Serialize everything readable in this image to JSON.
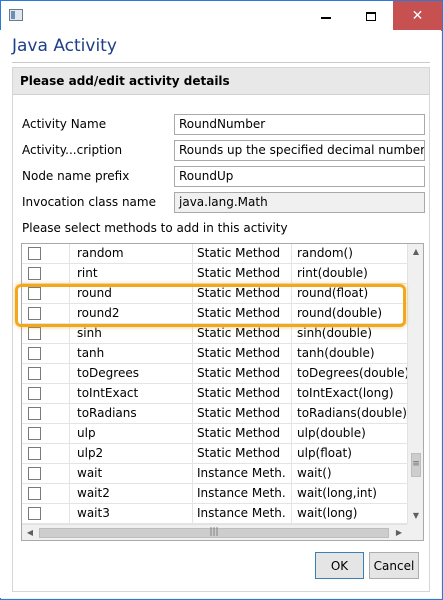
{
  "window": {
    "title": "Java Activity",
    "buttons": {
      "minimize": "minimize",
      "maximize": "maximize",
      "close": "✕"
    }
  },
  "panel": {
    "header": "Please add/edit activity details"
  },
  "fields": {
    "activity_name": {
      "label": "Activity Name",
      "value": "RoundNumber"
    },
    "description": {
      "label": "Activity...cription",
      "value": "Rounds up the specified decimal number to th"
    },
    "node_prefix": {
      "label": "Node name prefix",
      "value": "RoundUp"
    },
    "class_name": {
      "label": "Invocation class name",
      "value": "java.lang.Math"
    }
  },
  "methods_label": "Please select methods to add in this activity",
  "methods": [
    {
      "name": "random",
      "type": "Static Method",
      "signature": "random()",
      "checked": false
    },
    {
      "name": "rint",
      "type": "Static Method",
      "signature": "rint(double)",
      "checked": false
    },
    {
      "name": "round",
      "type": "Static Method",
      "signature": "round(float)",
      "checked": false
    },
    {
      "name": "round2",
      "type": "Static Method",
      "signature": "round(double)",
      "checked": false
    },
    {
      "name": "sinh",
      "type": "Static Method",
      "signature": "sinh(double)",
      "checked": false
    },
    {
      "name": "tanh",
      "type": "Static Method",
      "signature": "tanh(double)",
      "checked": false
    },
    {
      "name": "toDegrees",
      "type": "Static Method",
      "signature": "toDegrees(double)",
      "checked": false
    },
    {
      "name": "toIntExact",
      "type": "Static Method",
      "signature": "toIntExact(long)",
      "checked": false
    },
    {
      "name": "toRadians",
      "type": "Static Method",
      "signature": "toRadians(double)",
      "checked": false
    },
    {
      "name": "ulp",
      "type": "Static Method",
      "signature": "ulp(double)",
      "checked": false
    },
    {
      "name": "ulp2",
      "type": "Static Method",
      "signature": "ulp(float)",
      "checked": false
    },
    {
      "name": "wait",
      "type": "Instance Meth...",
      "signature": "wait()",
      "checked": false
    },
    {
      "name": "wait2",
      "type": "Instance Meth...",
      "signature": "wait(long,int)",
      "checked": false
    },
    {
      "name": "wait3",
      "type": "Instance Meth...",
      "signature": "wait(long)",
      "checked": false
    }
  ],
  "scroll": {
    "up": "▲",
    "down": "▼",
    "left": "◀",
    "right": "▶",
    "grip": "≡",
    "hgrip": "|||"
  },
  "footer": {
    "ok": "OK",
    "cancel": "Cancel"
  },
  "colors": {
    "title": "#1e3e8a",
    "close": "#c75050",
    "highlight": "#f2a71d"
  }
}
